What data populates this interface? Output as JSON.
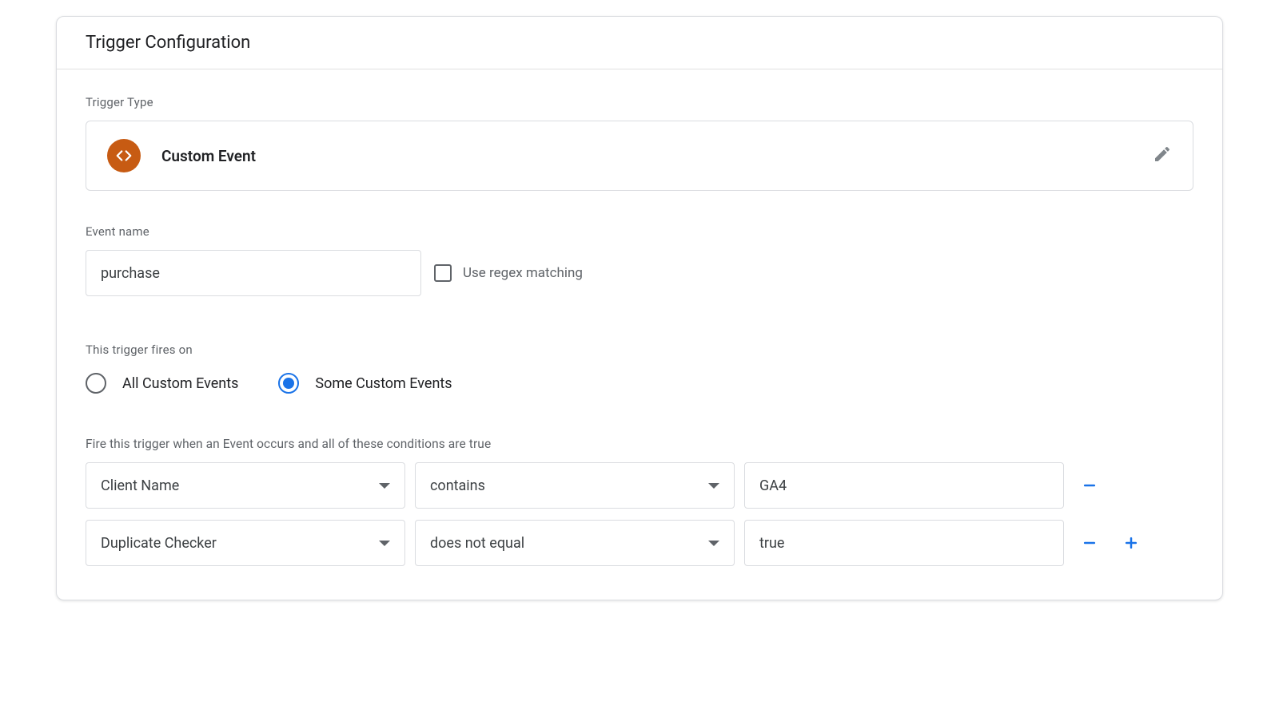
{
  "header": {
    "title": "Trigger Configuration"
  },
  "trigger_type": {
    "label": "Trigger Type",
    "name": "Custom Event"
  },
  "event_name": {
    "label": "Event name",
    "value": "purchase",
    "regex_label": "Use regex matching"
  },
  "fires_on": {
    "label": "This trigger fires on",
    "options": [
      {
        "label": "All Custom Events",
        "selected": false
      },
      {
        "label": "Some Custom Events",
        "selected": true
      }
    ]
  },
  "conditions": {
    "label": "Fire this trigger when an Event occurs and all of these conditions are true",
    "rows": [
      {
        "variable": "Client Name",
        "operator": "contains",
        "value": "GA4"
      },
      {
        "variable": "Duplicate Checker",
        "operator": "does not equal",
        "value": "true"
      }
    ]
  }
}
